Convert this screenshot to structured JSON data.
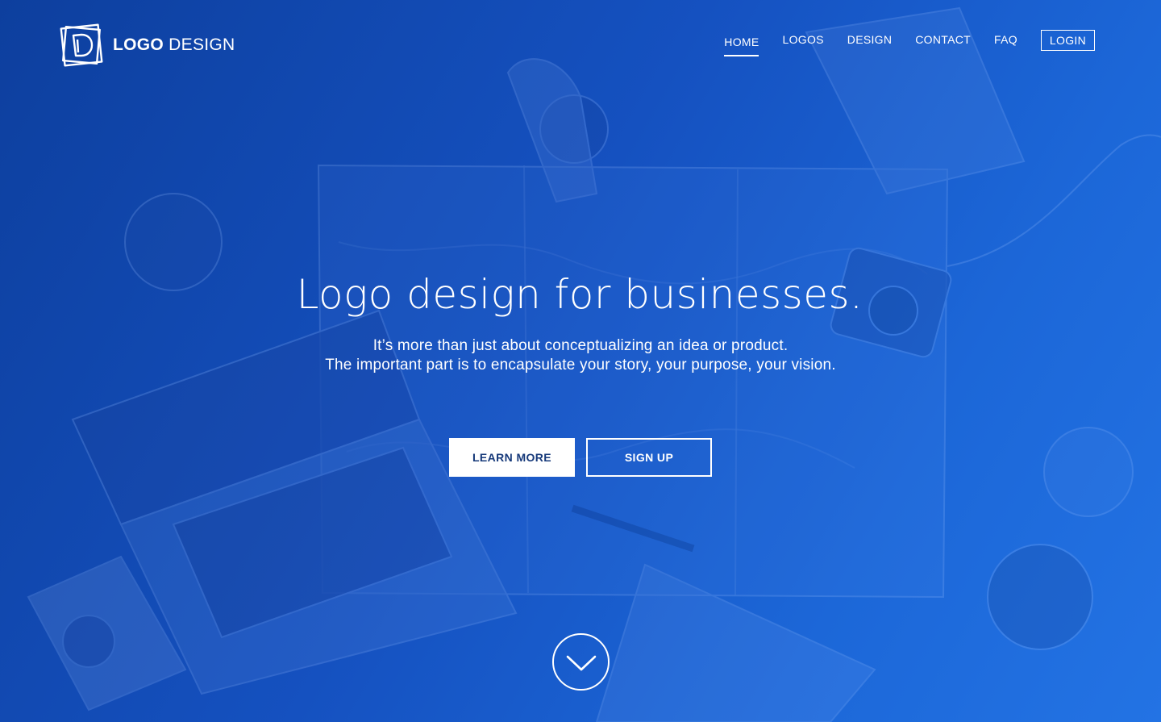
{
  "brand": {
    "name_bold": "LOGO",
    "name_light": "DESIGN",
    "logo_icon": "logo-d-mark-icon"
  },
  "nav": {
    "items": [
      {
        "label": "HOME",
        "active": true
      },
      {
        "label": "LOGOS",
        "active": false
      },
      {
        "label": "DESIGN",
        "active": false
      },
      {
        "label": "CONTACT",
        "active": false
      },
      {
        "label": "FAQ",
        "active": false
      }
    ],
    "login_label": "LOGIN"
  },
  "hero": {
    "headline": "Logo design for businesses.",
    "subline_1": "It’s more than just about conceptualizing an idea or product.",
    "subline_2": "The important part is to encapsulate your story, your purpose, your vision.",
    "learn_more_label": "LEARN MORE",
    "sign_up_label": "SIGN UP",
    "scroll_icon": "chevron-down-circle-icon"
  },
  "colors": {
    "overlay_dark": "#0d3f9e",
    "overlay_light": "#2373e4",
    "button_text": "#16397a",
    "white": "#ffffff"
  }
}
